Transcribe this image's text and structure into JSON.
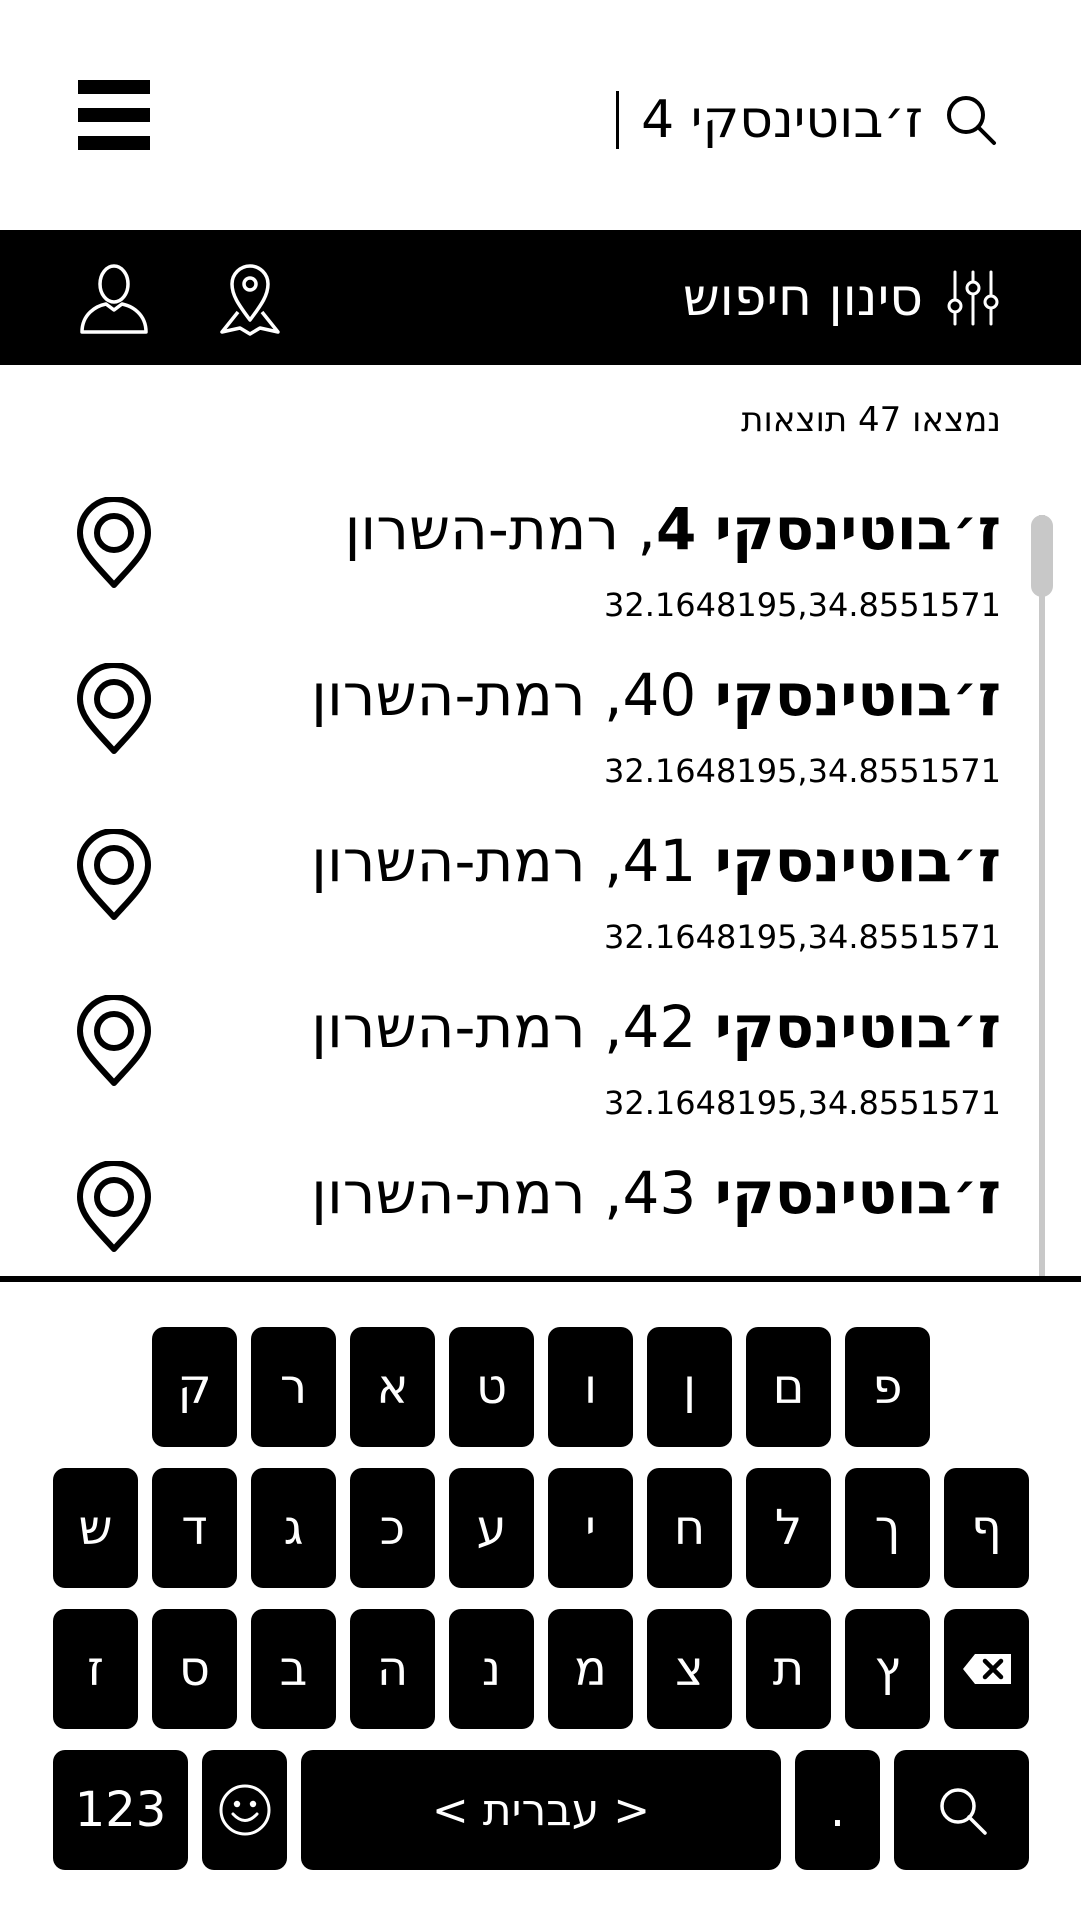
{
  "search": {
    "value": "ז׳בוטינסקי 4",
    "icon": "search-icon"
  },
  "filter_bar": {
    "filter_label": "סינון חיפוש",
    "filter_icon": "sliders-icon",
    "map_icon": "map-pin-icon",
    "user_icon": "user-icon"
  },
  "results": {
    "count_text": "נמצאו 47 תוצאות",
    "items": [
      {
        "street": "ז׳בוטינסקי",
        "number": "4",
        "city_part": ", רמת-השרון",
        "coords": "32.1648195,34.8551571"
      },
      {
        "street": "ז׳בוטינסקי",
        "number": "40",
        "city_part": ", רמת-השרון",
        "coords": "32.1648195,34.8551571"
      },
      {
        "street": "ז׳בוטינסקי",
        "number": "41",
        "city_part": ", רמת-השרון",
        "coords": "32.1648195,34.8551571"
      },
      {
        "street": "ז׳בוטינסקי",
        "number": "42",
        "city_part": ", רמת-השרון",
        "coords": "32.1648195,34.8551571"
      },
      {
        "street": "ז׳בוטינסקי",
        "number": "43",
        "city_part": ", רמת-השרון",
        "coords": ""
      }
    ]
  },
  "keyboard": {
    "row1": [
      "ק",
      "ר",
      "א",
      "ט",
      "ו",
      "ן",
      "ם",
      "פ"
    ],
    "row2": [
      "ש",
      "ד",
      "ג",
      "כ",
      "ע",
      "י",
      "ח",
      "ל",
      "ך",
      "ף"
    ],
    "row3": [
      "ז",
      "ס",
      "ב",
      "ה",
      "נ",
      "מ",
      "צ",
      "ת",
      "ץ"
    ],
    "numbers_key": "123",
    "space_key": "< עברית >",
    "period_key": "."
  },
  "colors": {
    "accent": "#000000",
    "background": "#ffffff",
    "scrollbar": "#c8c8c8"
  }
}
